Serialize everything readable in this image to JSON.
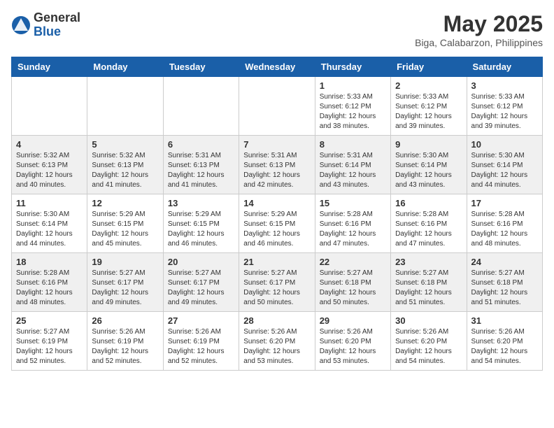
{
  "header": {
    "logo_general": "General",
    "logo_blue": "Blue",
    "month_title": "May 2025",
    "location": "Biga, Calabarzon, Philippines"
  },
  "days_of_week": [
    "Sunday",
    "Monday",
    "Tuesday",
    "Wednesday",
    "Thursday",
    "Friday",
    "Saturday"
  ],
  "weeks": [
    [
      {
        "day": "",
        "info": ""
      },
      {
        "day": "",
        "info": ""
      },
      {
        "day": "",
        "info": ""
      },
      {
        "day": "",
        "info": ""
      },
      {
        "day": "1",
        "info": "Sunrise: 5:33 AM\nSunset: 6:12 PM\nDaylight: 12 hours\nand 38 minutes."
      },
      {
        "day": "2",
        "info": "Sunrise: 5:33 AM\nSunset: 6:12 PM\nDaylight: 12 hours\nand 39 minutes."
      },
      {
        "day": "3",
        "info": "Sunrise: 5:33 AM\nSunset: 6:12 PM\nDaylight: 12 hours\nand 39 minutes."
      }
    ],
    [
      {
        "day": "4",
        "info": "Sunrise: 5:32 AM\nSunset: 6:13 PM\nDaylight: 12 hours\nand 40 minutes."
      },
      {
        "day": "5",
        "info": "Sunrise: 5:32 AM\nSunset: 6:13 PM\nDaylight: 12 hours\nand 41 minutes."
      },
      {
        "day": "6",
        "info": "Sunrise: 5:31 AM\nSunset: 6:13 PM\nDaylight: 12 hours\nand 41 minutes."
      },
      {
        "day": "7",
        "info": "Sunrise: 5:31 AM\nSunset: 6:13 PM\nDaylight: 12 hours\nand 42 minutes."
      },
      {
        "day": "8",
        "info": "Sunrise: 5:31 AM\nSunset: 6:14 PM\nDaylight: 12 hours\nand 43 minutes."
      },
      {
        "day": "9",
        "info": "Sunrise: 5:30 AM\nSunset: 6:14 PM\nDaylight: 12 hours\nand 43 minutes."
      },
      {
        "day": "10",
        "info": "Sunrise: 5:30 AM\nSunset: 6:14 PM\nDaylight: 12 hours\nand 44 minutes."
      }
    ],
    [
      {
        "day": "11",
        "info": "Sunrise: 5:30 AM\nSunset: 6:14 PM\nDaylight: 12 hours\nand 44 minutes."
      },
      {
        "day": "12",
        "info": "Sunrise: 5:29 AM\nSunset: 6:15 PM\nDaylight: 12 hours\nand 45 minutes."
      },
      {
        "day": "13",
        "info": "Sunrise: 5:29 AM\nSunset: 6:15 PM\nDaylight: 12 hours\nand 46 minutes."
      },
      {
        "day": "14",
        "info": "Sunrise: 5:29 AM\nSunset: 6:15 PM\nDaylight: 12 hours\nand 46 minutes."
      },
      {
        "day": "15",
        "info": "Sunrise: 5:28 AM\nSunset: 6:16 PM\nDaylight: 12 hours\nand 47 minutes."
      },
      {
        "day": "16",
        "info": "Sunrise: 5:28 AM\nSunset: 6:16 PM\nDaylight: 12 hours\nand 47 minutes."
      },
      {
        "day": "17",
        "info": "Sunrise: 5:28 AM\nSunset: 6:16 PM\nDaylight: 12 hours\nand 48 minutes."
      }
    ],
    [
      {
        "day": "18",
        "info": "Sunrise: 5:28 AM\nSunset: 6:16 PM\nDaylight: 12 hours\nand 48 minutes."
      },
      {
        "day": "19",
        "info": "Sunrise: 5:27 AM\nSunset: 6:17 PM\nDaylight: 12 hours\nand 49 minutes."
      },
      {
        "day": "20",
        "info": "Sunrise: 5:27 AM\nSunset: 6:17 PM\nDaylight: 12 hours\nand 49 minutes."
      },
      {
        "day": "21",
        "info": "Sunrise: 5:27 AM\nSunset: 6:17 PM\nDaylight: 12 hours\nand 50 minutes."
      },
      {
        "day": "22",
        "info": "Sunrise: 5:27 AM\nSunset: 6:18 PM\nDaylight: 12 hours\nand 50 minutes."
      },
      {
        "day": "23",
        "info": "Sunrise: 5:27 AM\nSunset: 6:18 PM\nDaylight: 12 hours\nand 51 minutes."
      },
      {
        "day": "24",
        "info": "Sunrise: 5:27 AM\nSunset: 6:18 PM\nDaylight: 12 hours\nand 51 minutes."
      }
    ],
    [
      {
        "day": "25",
        "info": "Sunrise: 5:27 AM\nSunset: 6:19 PM\nDaylight: 12 hours\nand 52 minutes."
      },
      {
        "day": "26",
        "info": "Sunrise: 5:26 AM\nSunset: 6:19 PM\nDaylight: 12 hours\nand 52 minutes."
      },
      {
        "day": "27",
        "info": "Sunrise: 5:26 AM\nSunset: 6:19 PM\nDaylight: 12 hours\nand 52 minutes."
      },
      {
        "day": "28",
        "info": "Sunrise: 5:26 AM\nSunset: 6:20 PM\nDaylight: 12 hours\nand 53 minutes."
      },
      {
        "day": "29",
        "info": "Sunrise: 5:26 AM\nSunset: 6:20 PM\nDaylight: 12 hours\nand 53 minutes."
      },
      {
        "day": "30",
        "info": "Sunrise: 5:26 AM\nSunset: 6:20 PM\nDaylight: 12 hours\nand 54 minutes."
      },
      {
        "day": "31",
        "info": "Sunrise: 5:26 AM\nSunset: 6:20 PM\nDaylight: 12 hours\nand 54 minutes."
      }
    ]
  ]
}
